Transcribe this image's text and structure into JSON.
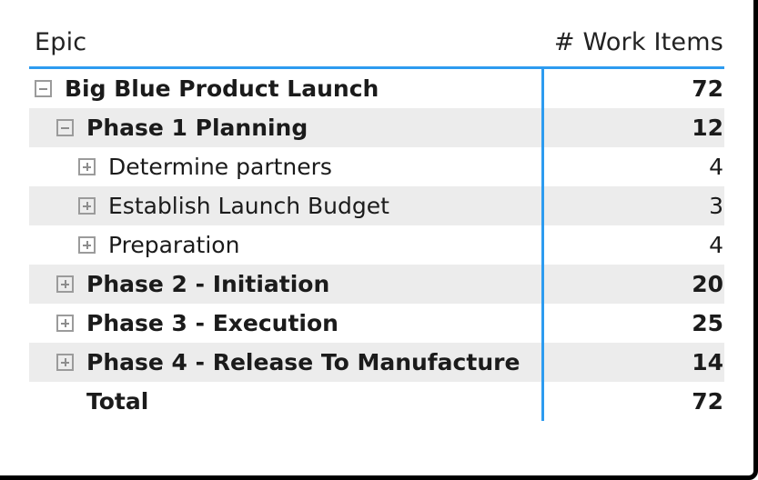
{
  "header": {
    "label_column": "Epic",
    "value_column": "# Work Items"
  },
  "colors": {
    "accent_line": "#2d9bf0",
    "row_shade": "#ececec",
    "text": "#1b1b1b",
    "expander_border": "#9b9b9b",
    "card_border": "#000000"
  },
  "rows": [
    {
      "label": "Big Blue Product Launch",
      "value": "72",
      "indent": 0,
      "bold": true,
      "icon": "collapse-minus-icon",
      "shaded": false
    },
    {
      "label": "Phase 1 Planning",
      "value": "12",
      "indent": 1,
      "bold": true,
      "icon": "collapse-minus-icon",
      "shaded": true
    },
    {
      "label": "Determine partners",
      "value": "4",
      "indent": 2,
      "bold": false,
      "icon": "expand-plus-icon",
      "shaded": false
    },
    {
      "label": "Establish Launch Budget",
      "value": "3",
      "indent": 2,
      "bold": false,
      "icon": "expand-plus-icon",
      "shaded": true
    },
    {
      "label": "Preparation",
      "value": "4",
      "indent": 2,
      "bold": false,
      "icon": "expand-plus-icon",
      "shaded": false
    },
    {
      "label": "Phase 2 - Initiation",
      "value": "20",
      "indent": 1,
      "bold": true,
      "icon": "expand-plus-icon",
      "shaded": true
    },
    {
      "label": "Phase 3 - Execution",
      "value": "25",
      "indent": 1,
      "bold": true,
      "icon": "expand-plus-icon",
      "shaded": false
    },
    {
      "label": "Phase 4 - Release To Manufacture",
      "value": "14",
      "indent": 1,
      "bold": true,
      "icon": "expand-plus-icon",
      "shaded": true
    },
    {
      "label": "Total",
      "value": "72",
      "indent": 1,
      "bold": true,
      "icon": "none",
      "shaded": false
    }
  ]
}
